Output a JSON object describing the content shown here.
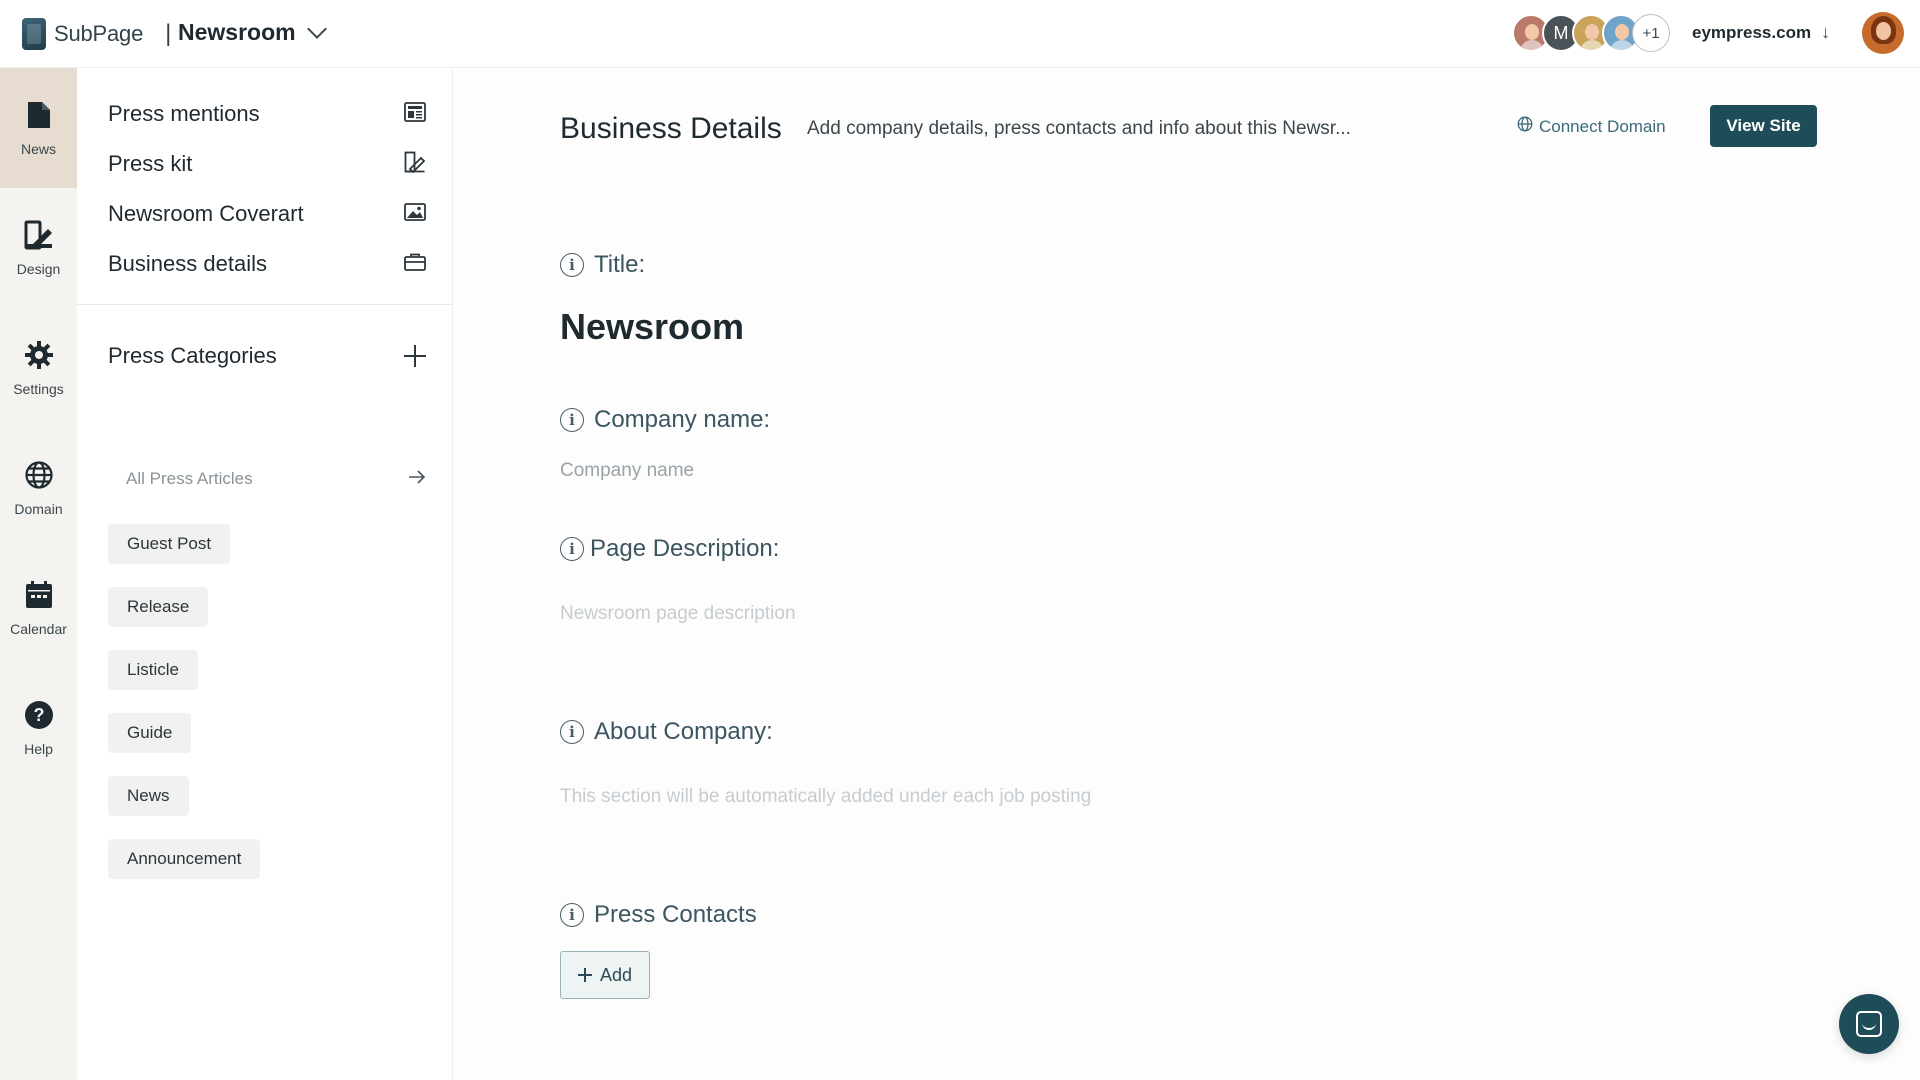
{
  "topbar": {
    "brand_sub": "Sub",
    "brand_page": "Page",
    "separator": "|",
    "workspace": "Newsroom",
    "avatars_more": "+1",
    "avatar_letter": "M",
    "domain": "eympress.com",
    "domain_arrow": "↓"
  },
  "rail": {
    "items": [
      {
        "label": "News",
        "icon": "document-icon"
      },
      {
        "label": "Design",
        "icon": "design-icon"
      },
      {
        "label": "Settings",
        "icon": "gear-icon"
      },
      {
        "label": "Domain",
        "icon": "globe-icon"
      },
      {
        "label": "Calendar",
        "icon": "calendar-icon"
      },
      {
        "label": "Help",
        "icon": "help-icon"
      }
    ]
  },
  "subnav": {
    "items": [
      {
        "label": "Press mentions",
        "icon": "newspaper-icon"
      },
      {
        "label": "Press kit",
        "icon": "design-icon"
      },
      {
        "label": "Newsroom Coverart",
        "icon": "image-icon"
      },
      {
        "label": "Business details",
        "icon": "briefcase-icon"
      }
    ],
    "categories_title": "Press Categories",
    "all_articles": "All Press Articles",
    "categories": [
      "Guest Post",
      "Release",
      "Listicle",
      "Guide",
      "News",
      "Announcement"
    ]
  },
  "main": {
    "title": "Business Details",
    "subtitle": "Add company details, press contacts and info about this Newsr...",
    "connect_domain": "Connect Domain",
    "view_site": "View Site",
    "title_label": "Title:",
    "title_value": "Newsroom",
    "company_label": "Company name:",
    "company_placeholder": "Company name",
    "description_label": "Page Description:",
    "description_placeholder": "Newsroom page description",
    "about_label": "About Company:",
    "about_placeholder": "This section will be automatically added under each job posting",
    "contacts_label": "Press Contacts",
    "add_label": "Add"
  }
}
